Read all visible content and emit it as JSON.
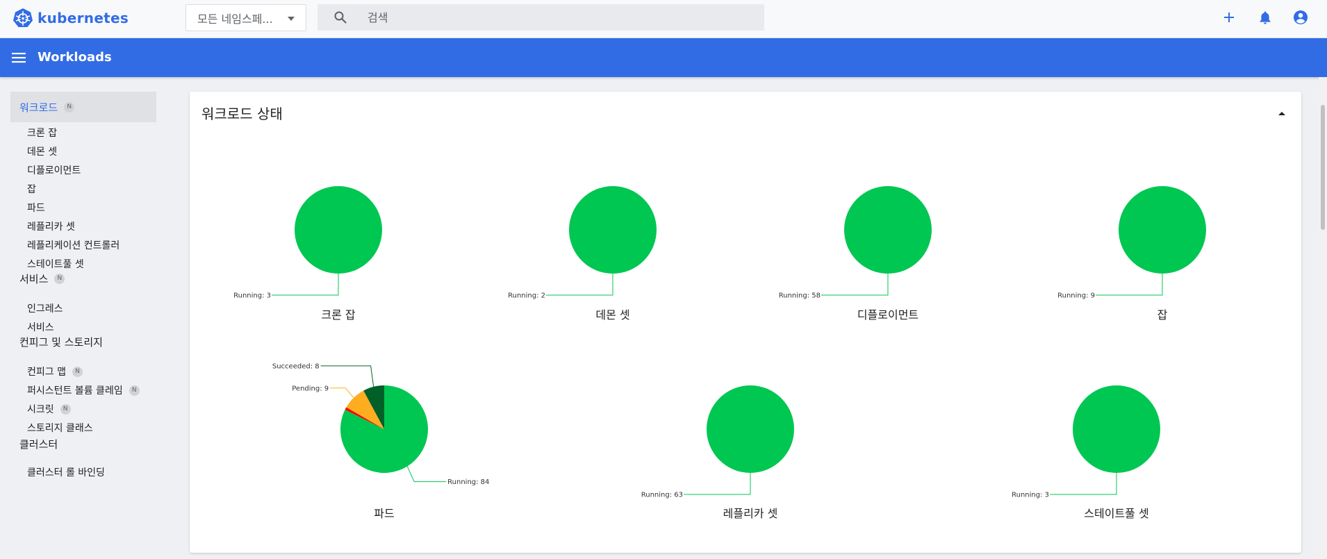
{
  "brand": {
    "name": "kubernetes",
    "color": "#326ce5"
  },
  "topbar": {
    "namespace_select": {
      "value": "모든 네임스페..."
    },
    "search": {
      "placeholder": "검색",
      "icon": "search-icon"
    },
    "actions": [
      {
        "name": "add-icon"
      },
      {
        "name": "notifications-icon"
      },
      {
        "name": "account-icon"
      }
    ]
  },
  "appbar": {
    "title": "Workloads",
    "color": "#326ce5"
  },
  "sidebar": {
    "sections": [
      {
        "label": "워크로드",
        "badge": "N",
        "active": true,
        "items": [
          "크론 잡",
          "데몬 셋",
          "디플로이먼트",
          "잡",
          "파드",
          "레플리카 셋",
          "레플리케이션 컨트롤러",
          "스테이트풀 셋"
        ]
      },
      {
        "label": "서비스",
        "badge": "N",
        "items": [
          "인그레스",
          "서비스"
        ]
      },
      {
        "label": "컨피그 및 스토리지",
        "items": [
          {
            "label": "컨피그 맵",
            "badge": "N"
          },
          {
            "label": "퍼시스턴트 볼륨 클레임",
            "badge": "N"
          },
          {
            "label": "시크릿",
            "badge": "N"
          },
          {
            "label": "스토리지 클래스"
          }
        ]
      },
      {
        "label": "클러스터",
        "items": [
          "클러스터 롤 바인딩"
        ]
      }
    ]
  },
  "card": {
    "title": "워크로드 상태"
  },
  "colors": {
    "running": "#00c752",
    "pending": "#ffad20",
    "succeeded": "#006028",
    "failed": "#f00"
  },
  "chart_data": [
    {
      "type": "pie",
      "title": "크론 잡",
      "slices": [
        {
          "label": "Running",
          "value": 3
        }
      ]
    },
    {
      "type": "pie",
      "title": "데몬 셋",
      "slices": [
        {
          "label": "Running",
          "value": 2
        }
      ]
    },
    {
      "type": "pie",
      "title": "디플로이먼트",
      "slices": [
        {
          "label": "Running",
          "value": 58
        }
      ]
    },
    {
      "type": "pie",
      "title": "잡",
      "slices": [
        {
          "label": "Running",
          "value": 9
        }
      ]
    },
    {
      "type": "pie",
      "title": "파드",
      "slices": [
        {
          "label": "Running",
          "value": 84
        },
        {
          "label": "Failed",
          "value": 1
        },
        {
          "label": "Pending",
          "value": 9
        },
        {
          "label": "Succeeded",
          "value": 8
        }
      ]
    },
    {
      "type": "pie",
      "title": "레플리카 셋",
      "slices": [
        {
          "label": "Running",
          "value": 63
        }
      ]
    },
    {
      "type": "pie",
      "title": "스테이트풀 셋",
      "slices": [
        {
          "label": "Running",
          "value": 3
        }
      ]
    }
  ]
}
